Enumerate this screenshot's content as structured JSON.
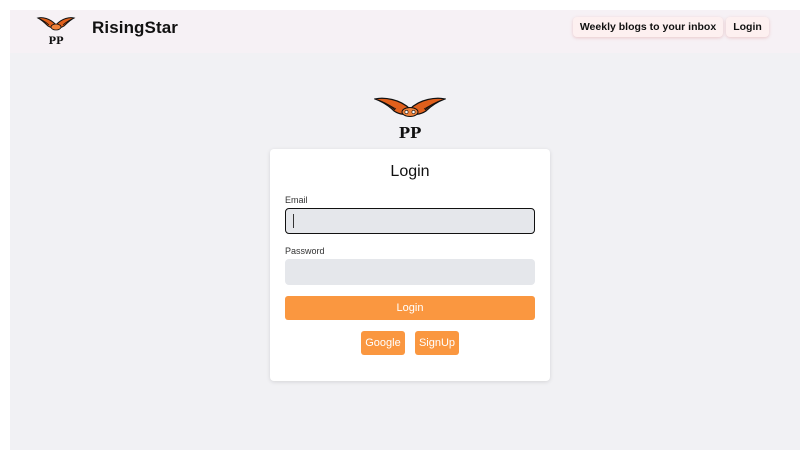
{
  "navbar": {
    "brand_name": "RisingStar",
    "logo_text": "PP",
    "newsletter_label": "Weekly blogs to your inbox",
    "login_label": "Login"
  },
  "logo": {
    "text": "PP",
    "icon": "eagle-icon"
  },
  "login_form": {
    "title": "Login",
    "email_label": "Email",
    "email_value": "",
    "password_label": "Password",
    "password_value": "",
    "submit_label": "Login",
    "google_label": "Google",
    "signup_label": "SignUp"
  },
  "colors": {
    "accent": "#fa9740",
    "background": "#f1f1f4",
    "navbar": "#f6f1f5",
    "input_bg": "#e5e7eb"
  }
}
